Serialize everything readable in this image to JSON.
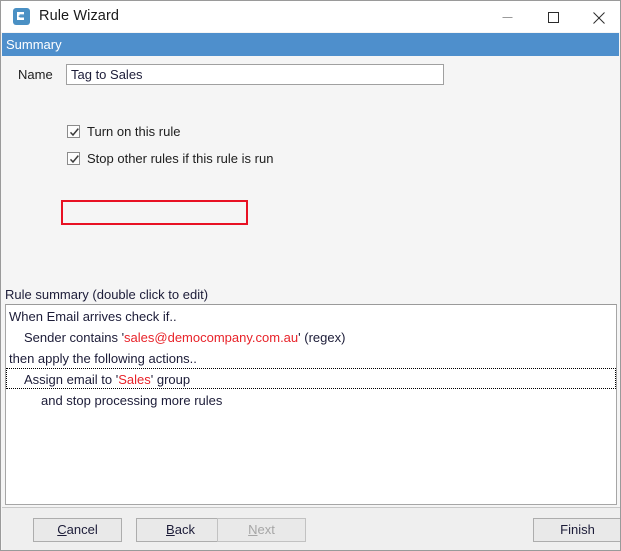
{
  "window": {
    "title": "Rule Wizard",
    "icon": "app-logo-icon",
    "controls": {
      "minimize": "minimize-icon",
      "maximize": "maximize-icon",
      "close": "close-icon"
    }
  },
  "header": {
    "step_title": "Summary",
    "accent_color": "#4e8fcc"
  },
  "form": {
    "name_label": "Name",
    "name_value": "Tag to Sales",
    "name_placeholder": "",
    "checkboxes": [
      {
        "label": "Turn on this rule",
        "checked": true,
        "highlighted": false
      },
      {
        "label": "Stop other rules if this rule is run",
        "checked": true,
        "highlighted": true
      }
    ],
    "highlight_color": "#e81123"
  },
  "rule_summary": {
    "label": "Rule summary (double click to edit)",
    "rows": [
      {
        "indent": 0,
        "pre": "When Email arrives check if..",
        "highlight": "",
        "post": "",
        "selected": false
      },
      {
        "indent": 1,
        "pre": "Sender contains '",
        "highlight": "sales@democompany.com.au",
        "post": "' (regex)",
        "selected": false
      },
      {
        "indent": 0,
        "pre": "then apply the following actions..",
        "highlight": "",
        "post": "",
        "selected": false
      },
      {
        "indent": 1,
        "pre": "Assign email to '",
        "highlight": "Sales",
        "post": "' group",
        "selected": true
      },
      {
        "indent": 2,
        "pre": "and stop processing more rules",
        "highlight": "",
        "post": "",
        "selected": false
      }
    ],
    "highlight_color": "#e8232a"
  },
  "footer": {
    "buttons": [
      {
        "label": "Cancel",
        "mnemonic": "C",
        "disabled": false
      },
      {
        "label": "Back",
        "mnemonic": "B",
        "disabled": false
      },
      {
        "label": "Next",
        "mnemonic": "N",
        "disabled": true
      },
      {
        "label": "Finish",
        "mnemonic": "",
        "disabled": false
      }
    ]
  }
}
